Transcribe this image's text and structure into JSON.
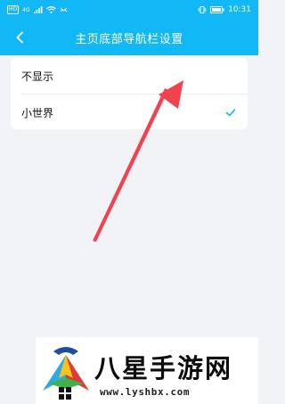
{
  "status_bar": {
    "hd_label": "HD",
    "signal_label": "4G",
    "time": "10:31"
  },
  "header": {
    "title": "主页底部导航栏设置",
    "back_icon": "chevron-left-icon"
  },
  "options": [
    {
      "label": "不显示",
      "selected": false
    },
    {
      "label": "小世界",
      "selected": true
    }
  ],
  "colors": {
    "header_bg": "#12b7f5",
    "check": "#12b7f5",
    "annotation_arrow": "#f2424f"
  },
  "watermark": {
    "brand": "八星手游网",
    "url": "www.lyshbx.com"
  }
}
